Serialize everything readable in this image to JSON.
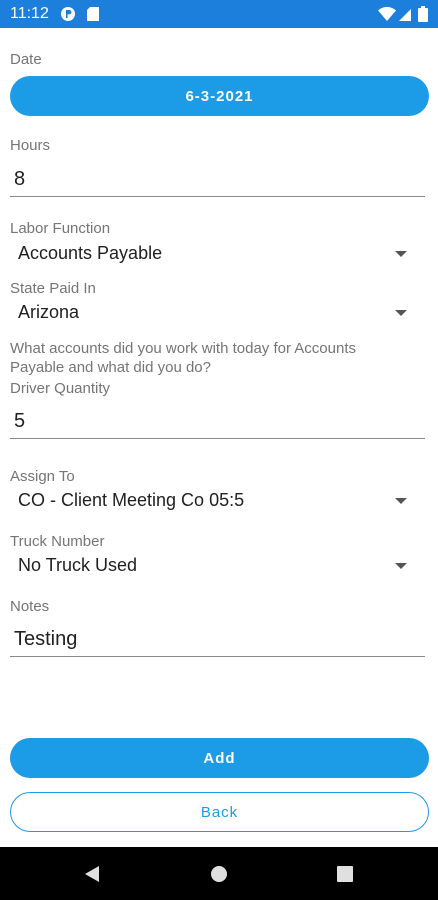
{
  "status_bar": {
    "time": "11:12",
    "icons": [
      "app-notification-icon",
      "sd-card-icon",
      "wifi-icon",
      "cell-signal-icon",
      "battery-icon"
    ],
    "color": "#1c7fdc"
  },
  "form": {
    "date": {
      "label": "Date",
      "value": "6-3-2021"
    },
    "hours": {
      "label": "Hours",
      "value": "8"
    },
    "labor_function": {
      "label": "Labor Function",
      "value": "Accounts Payable"
    },
    "state_paid_in": {
      "label": "State Paid In",
      "value": "Arizona"
    },
    "question": "What accounts did you work with today for Accounts Payable and what did you do?",
    "driver_quantity": {
      "label": "Driver Quantity",
      "value": "5"
    },
    "assign_to": {
      "label": "Assign To",
      "value": "CO - Client Meeting Co 05:5"
    },
    "truck_number": {
      "label": "Truck Number",
      "value": "No Truck Used"
    },
    "notes": {
      "label": "Notes",
      "value": "Testing"
    }
  },
  "actions": {
    "add_label": "Add",
    "back_label": "Back"
  },
  "nav": {
    "icons": [
      "back-triangle-icon",
      "home-circle-icon",
      "recents-square-icon"
    ]
  },
  "colors": {
    "accent": "#1c9be6",
    "status_bar": "#1c7fdc",
    "label": "#757575"
  }
}
